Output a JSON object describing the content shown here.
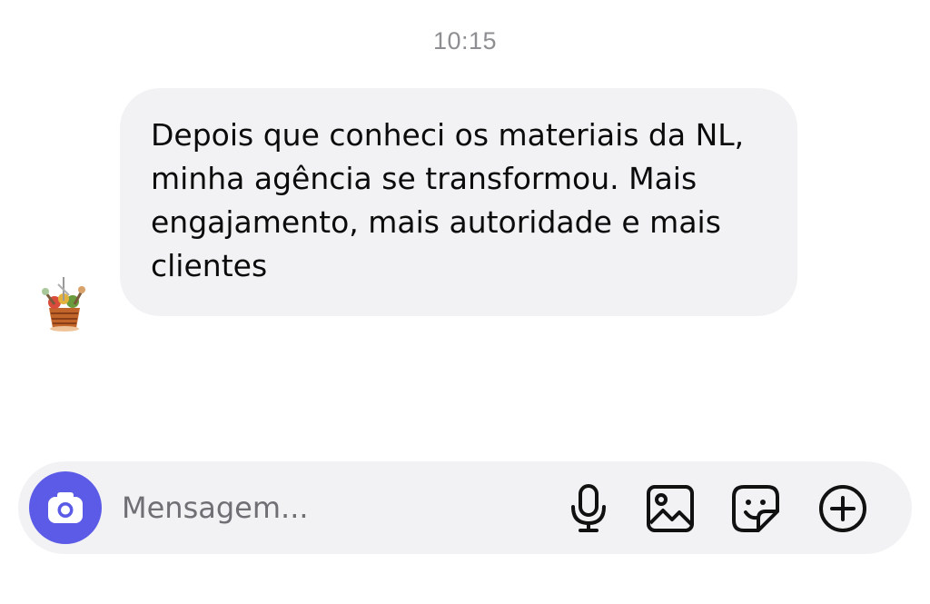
{
  "thread": {
    "timestamp": "10:15"
  },
  "message": {
    "text": "Depois que conheci os materiais da NL, minha agência se transformou. Mais engajamento, mais autoridade e mais clientes",
    "avatar_icon": "sender-avatar"
  },
  "composer": {
    "placeholder": "Mensagem...",
    "value": "",
    "camera_icon": "camera-icon",
    "mic_icon": "microphone-icon",
    "gallery_icon": "image-icon",
    "sticker_icon": "sticker-icon",
    "more_icon": "plus-circle-icon"
  },
  "colors": {
    "accent": "#5b5be8",
    "bubble": "#f2f2f5",
    "timestamp": "#8e8e93"
  }
}
